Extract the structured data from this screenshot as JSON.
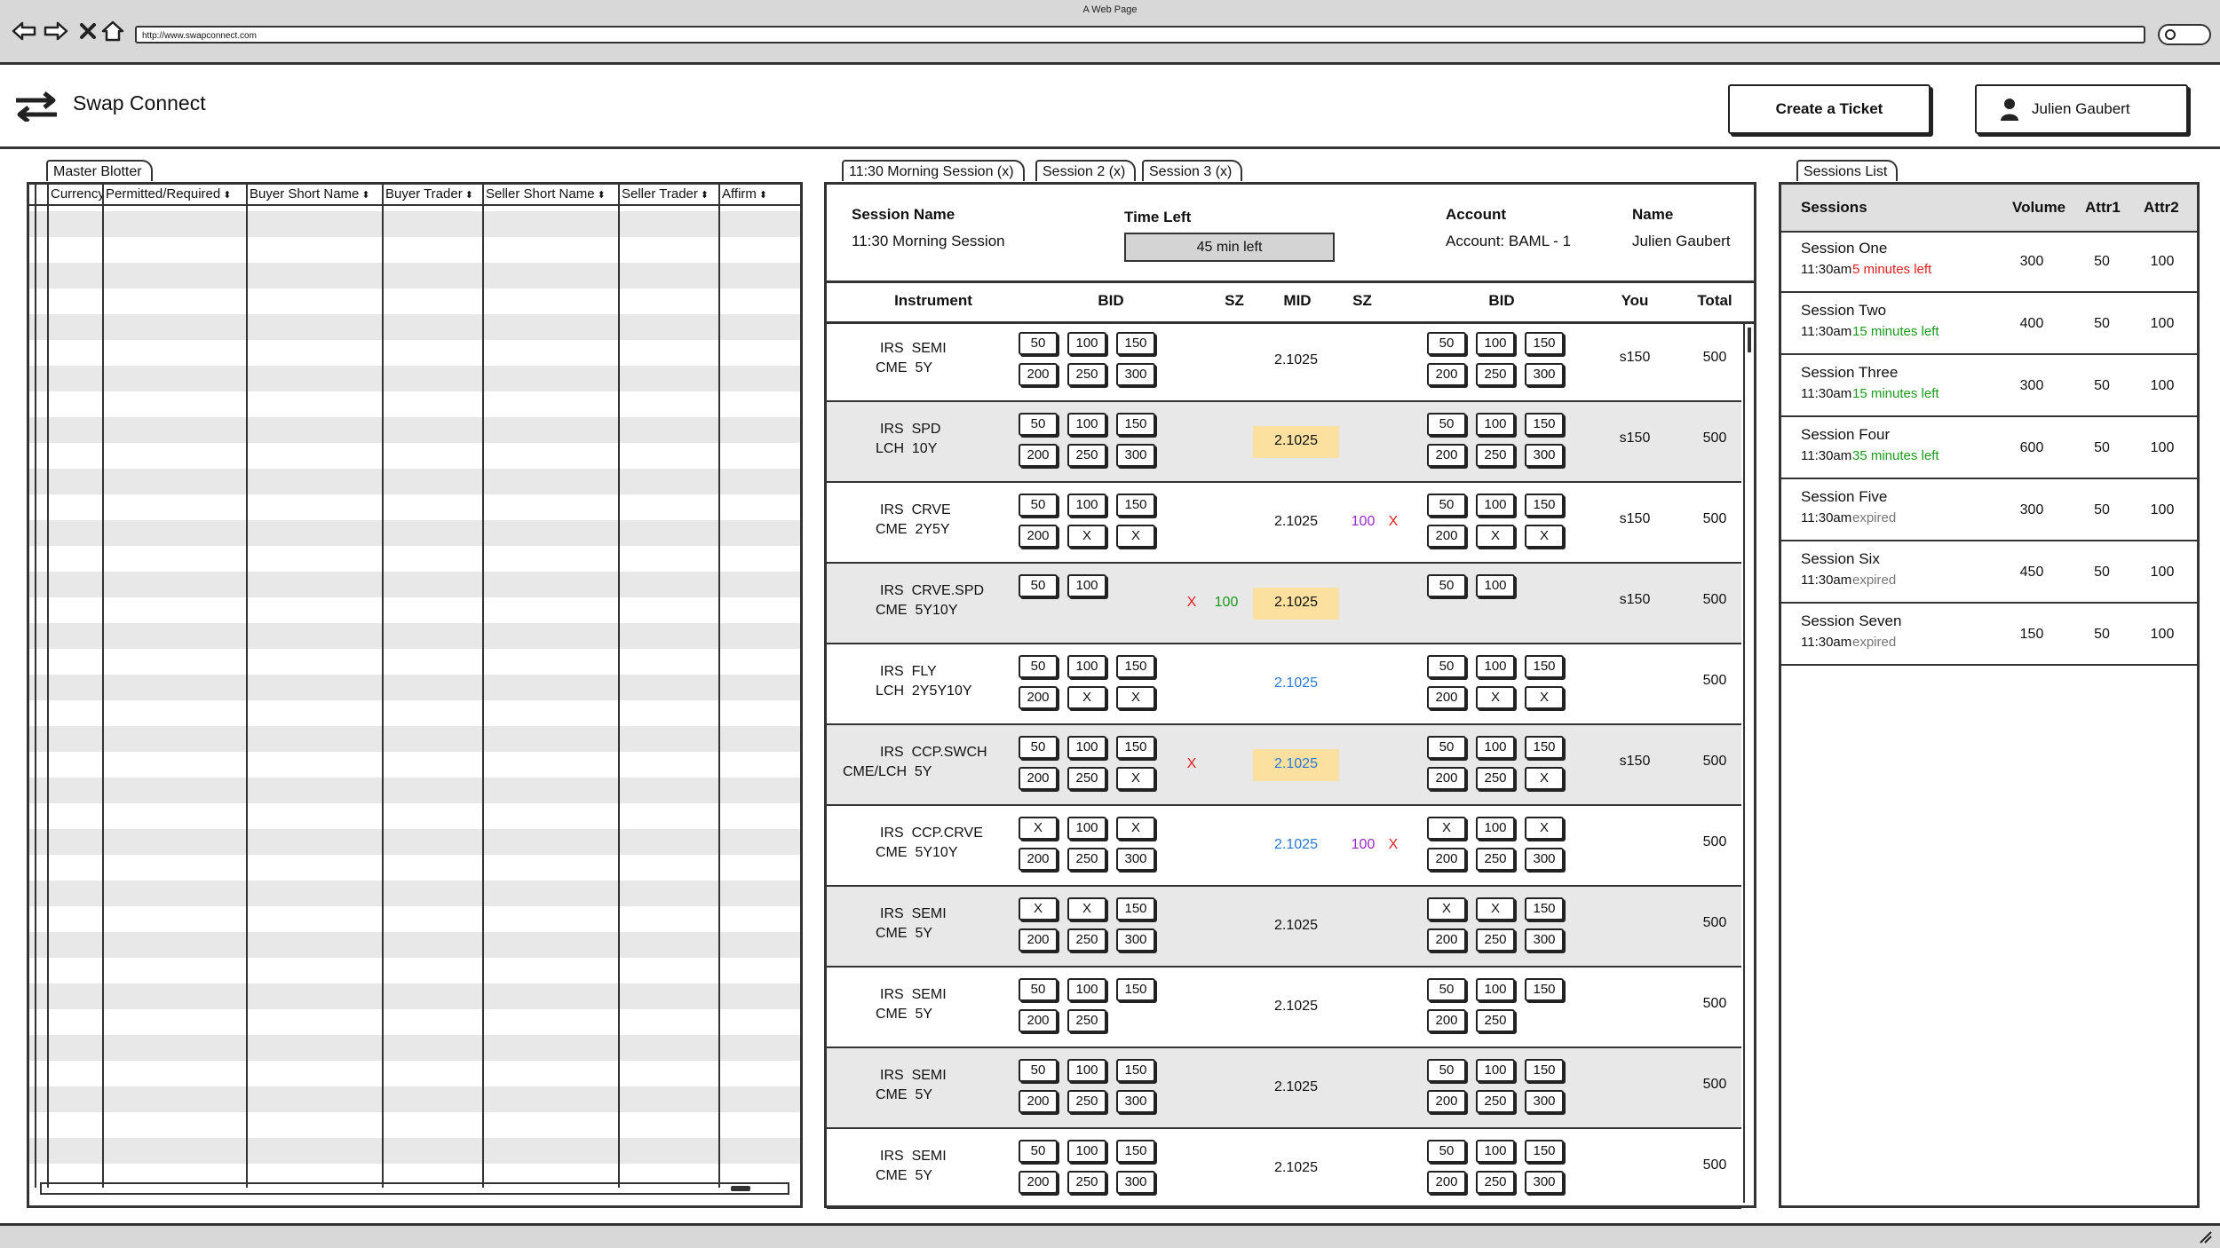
{
  "browser": {
    "window_title": "A Web Page",
    "url": "http://www.swapconnect.com"
  },
  "header": {
    "app_title": "Swap Connect",
    "create_ticket_label": "Create a Ticket",
    "user_name": "Julien Gaubert"
  },
  "blotter": {
    "tab_label": "Master Blotter",
    "columns": [
      "Currency",
      "Permitted/Required",
      "Buyer Short Name",
      "Buyer Trader",
      "Seller Short Name",
      "Seller Trader",
      "Affirm"
    ]
  },
  "session_tabs": [
    "11:30 Morning Session (x)",
    "Session 2 (x)",
    "Session 3 (x)"
  ],
  "session_info": {
    "session_name_label": "Session Name",
    "session_name_value": "11:30 Morning Session",
    "time_left_label": "Time Left",
    "time_left_value": "45 min left",
    "account_label": "Account",
    "account_value": "Account: BAML - 1",
    "name_label": "Name",
    "name_value": "Julien Gaubert"
  },
  "grid": {
    "columns": [
      "Instrument",
      "BID",
      "SZ",
      "MID",
      "SZ",
      "BID",
      "You",
      "Total"
    ],
    "rows": [
      {
        "inst1": "IRS  SEMI",
        "inst2": "CME  5Y",
        "left": [
          "50",
          "100",
          "150",
          "200",
          "250",
          "300"
        ],
        "right": [
          "50",
          "100",
          "150",
          "200",
          "250",
          "300"
        ],
        "sz_left": [],
        "mid": "2.1025",
        "mid_style": "plain",
        "sz_right": [],
        "you": "s150",
        "total": "500",
        "alt": false
      },
      {
        "inst1": "IRS  SPD",
        "inst2": "LCH  10Y",
        "left": [
          "50",
          "100",
          "150",
          "200",
          "250",
          "300"
        ],
        "right": [
          "50",
          "100",
          "150",
          "200",
          "250",
          "300"
        ],
        "sz_left": [],
        "mid": "2.1025",
        "mid_style": "highlight",
        "sz_right": [],
        "you": "s150",
        "total": "500",
        "alt": true
      },
      {
        "inst1": "IRS  CRVE",
        "inst2": "CME  2Y5Y",
        "left": [
          "50",
          "100",
          "150",
          "200",
          "X",
          "X"
        ],
        "right": [
          "50",
          "100",
          "150",
          "200",
          "X",
          "X"
        ],
        "sz_left": [],
        "mid": "2.1025",
        "mid_style": "plain",
        "sz_right": [
          {
            "t": "100",
            "c": "purple"
          },
          {
            "t": "X",
            "c": "red"
          }
        ],
        "you": "s150",
        "total": "500",
        "alt": false
      },
      {
        "inst1": "IRS  CRVE.SPD",
        "inst2": "CME  5Y10Y",
        "left": [
          "50",
          "100"
        ],
        "right": [
          "50",
          "100"
        ],
        "sz_left": [
          {
            "t": "X",
            "c": "red"
          },
          {
            "t": "100",
            "c": "green"
          }
        ],
        "mid": "2.1025",
        "mid_style": "highlight",
        "sz_right": [],
        "you": "s150",
        "total": "500",
        "alt": true
      },
      {
        "inst1": "IRS  FLY",
        "inst2": "LCH  2Y5Y10Y",
        "left": [
          "50",
          "100",
          "150",
          "200",
          "X",
          "X"
        ],
        "right": [
          "50",
          "100",
          "150",
          "200",
          "X",
          "X"
        ],
        "sz_left": [],
        "mid": "2.1025",
        "mid_style": "blue",
        "sz_right": [],
        "you": "",
        "total": "500",
        "alt": false
      },
      {
        "inst1": "IRS  CCP.SWCH",
        "inst2": "CME/LCH  5Y",
        "left": [
          "50",
          "100",
          "150",
          "200",
          "250",
          "X"
        ],
        "right": [
          "50",
          "100",
          "150",
          "200",
          "250",
          "X"
        ],
        "sz_left": [
          {
            "t": "X",
            "c": "red"
          }
        ],
        "mid": "2.1025",
        "mid_style": "highlight-blue",
        "sz_right": [],
        "you": "s150",
        "total": "500",
        "alt": true
      },
      {
        "inst1": "IRS  CCP.CRVE",
        "inst2": "CME  5Y10Y",
        "left": [
          "X",
          "100",
          "X",
          "200",
          "250",
          "300"
        ],
        "right": [
          "X",
          "100",
          "X",
          "200",
          "250",
          "300"
        ],
        "sz_left": [],
        "mid": "2.1025",
        "mid_style": "blue",
        "sz_right": [
          {
            "t": "100",
            "c": "purple"
          },
          {
            "t": "X",
            "c": "red"
          }
        ],
        "you": "",
        "total": "500",
        "alt": false
      },
      {
        "inst1": "IRS  SEMI",
        "inst2": "CME  5Y",
        "left": [
          "X",
          "X",
          "150",
          "200",
          "250",
          "300"
        ],
        "right": [
          "X",
          "X",
          "150",
          "200",
          "250",
          "300"
        ],
        "sz_left": [],
        "mid": "2.1025",
        "mid_style": "plain",
        "sz_right": [],
        "you": "",
        "total": "500",
        "alt": true
      },
      {
        "inst1": "IRS  SEMI",
        "inst2": "CME  5Y",
        "left": [
          "50",
          "100",
          "150",
          "200",
          "250"
        ],
        "right": [
          "50",
          "100",
          "150",
          "200",
          "250"
        ],
        "sz_left": [],
        "mid": "2.1025",
        "mid_style": "plain",
        "sz_right": [],
        "you": "",
        "total": "500",
        "alt": false
      },
      {
        "inst1": "IRS  SEMI",
        "inst2": "CME  5Y",
        "left": [
          "50",
          "100",
          "150",
          "200",
          "250",
          "300"
        ],
        "right": [
          "50",
          "100",
          "150",
          "200",
          "250",
          "300"
        ],
        "sz_left": [],
        "mid": "2.1025",
        "mid_style": "plain",
        "sz_right": [],
        "you": "",
        "total": "500",
        "alt": true
      },
      {
        "inst1": "IRS  SEMI",
        "inst2": "CME  5Y",
        "left": [
          "50",
          "100",
          "150",
          "200",
          "250",
          "300"
        ],
        "right": [
          "50",
          "100",
          "150",
          "200",
          "250",
          "300"
        ],
        "sz_left": [],
        "mid": "2.1025",
        "mid_style": "plain",
        "sz_right": [],
        "you": "",
        "total": "500",
        "alt": false
      }
    ]
  },
  "sessions_list": {
    "tab_label": "Sessions List",
    "columns": [
      "Sessions",
      "Volume",
      "Attr1",
      "Attr2"
    ],
    "items": [
      {
        "name": "Session One",
        "time": "11:30am",
        "status": "5 minutes left",
        "status_color": "red",
        "volume": "300",
        "attr1": "50",
        "attr2": "100"
      },
      {
        "name": "Session Two",
        "time": "11:30am",
        "status": "15 minutes left",
        "status_color": "green",
        "volume": "400",
        "attr1": "50",
        "attr2": "100"
      },
      {
        "name": "Session Three",
        "time": "11:30am",
        "status": "15 minutes left",
        "status_color": "green",
        "volume": "300",
        "attr1": "50",
        "attr2": "100"
      },
      {
        "name": "Session Four",
        "time": "11:30am",
        "status": "35 minutes left",
        "status_color": "green",
        "volume": "600",
        "attr1": "50",
        "attr2": "100"
      },
      {
        "name": "Session Five",
        "time": "11:30am",
        "status": "expired",
        "status_color": "gray",
        "volume": "300",
        "attr1": "50",
        "attr2": "100"
      },
      {
        "name": "Session Six",
        "time": "11:30am",
        "status": "expired",
        "status_color": "gray",
        "volume": "450",
        "attr1": "50",
        "attr2": "100"
      },
      {
        "name": "Session Seven",
        "time": "11:30am",
        "status": "expired",
        "status_color": "gray",
        "volume": "150",
        "attr1": "50",
        "attr2": "100"
      }
    ]
  },
  "colors": {
    "red": "#e02020",
    "green": "#1a9a1a",
    "purple": "#9a28c8",
    "blue": "#2a78d8",
    "gray": "#777777",
    "highlight": "#fbe0a0"
  },
  "icons": [
    "back-arrow-icon",
    "forward-arrow-icon",
    "close-x-icon",
    "home-icon",
    "swap-arrows-icon",
    "user-icon",
    "resize-grip-icon"
  ]
}
